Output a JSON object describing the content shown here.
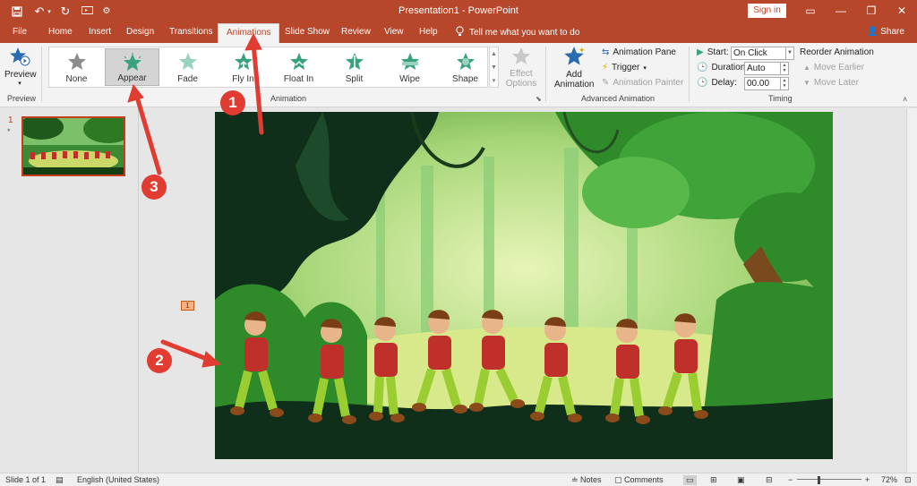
{
  "titlebar": {
    "title": "Presentation1  -  PowerPoint",
    "sign_in": "Sign in",
    "bg_color": "#b7472a"
  },
  "tabs": [
    {
      "label": "File"
    },
    {
      "label": "Home"
    },
    {
      "label": "Insert"
    },
    {
      "label": "Design"
    },
    {
      "label": "Transitions"
    },
    {
      "label": "Animations",
      "active": true
    },
    {
      "label": "Slide Show"
    },
    {
      "label": "Review"
    },
    {
      "label": "View"
    },
    {
      "label": "Help"
    }
  ],
  "tell_me": "Tell me what you want to do",
  "share": "Share",
  "ribbon": {
    "preview_group": {
      "button": "Preview",
      "label": "Preview"
    },
    "animation_group": {
      "label": "Animation",
      "items": [
        {
          "label": "None",
          "icon": "star-gray-icon"
        },
        {
          "label": "Appear",
          "icon": "star-appear-icon",
          "selected": true
        },
        {
          "label": "Fade",
          "icon": "star-fade-icon"
        },
        {
          "label": "Fly In",
          "icon": "star-flyin-icon"
        },
        {
          "label": "Float In",
          "icon": "star-floatin-icon"
        },
        {
          "label": "Split",
          "icon": "star-split-icon"
        },
        {
          "label": "Wipe",
          "icon": "star-wipe-icon"
        },
        {
          "label": "Shape",
          "icon": "star-shape-icon"
        }
      ],
      "effect_options": "Effect Options"
    },
    "advanced_group": {
      "label": "Advanced Animation",
      "add_animation": "Add Animation",
      "animation_pane": "Animation Pane",
      "trigger": "Trigger",
      "animation_painter": "Animation Painter"
    },
    "timing_group": {
      "label": "Timing",
      "start_label": "Start:",
      "start_value": "On Click",
      "duration_label": "Duration:",
      "duration_value": "Auto",
      "delay_label": "Delay:",
      "delay_value": "00.00",
      "reorder": "Reorder Animation",
      "move_earlier": "Move Earlier",
      "move_later": "Move Later"
    }
  },
  "slides_pane": {
    "slide_number": "1",
    "star": "*"
  },
  "canvas": {
    "anim_tag": "1"
  },
  "callouts": [
    "1",
    "2",
    "3"
  ],
  "status": {
    "slide": "Slide 1 of 1",
    "language": "English (United States)",
    "notes": "Notes",
    "comments": "Comments",
    "zoom": "72%"
  },
  "colors": {
    "accent": "#b7472a",
    "callout": "#e03c31",
    "star_green": "#3aa17e"
  }
}
